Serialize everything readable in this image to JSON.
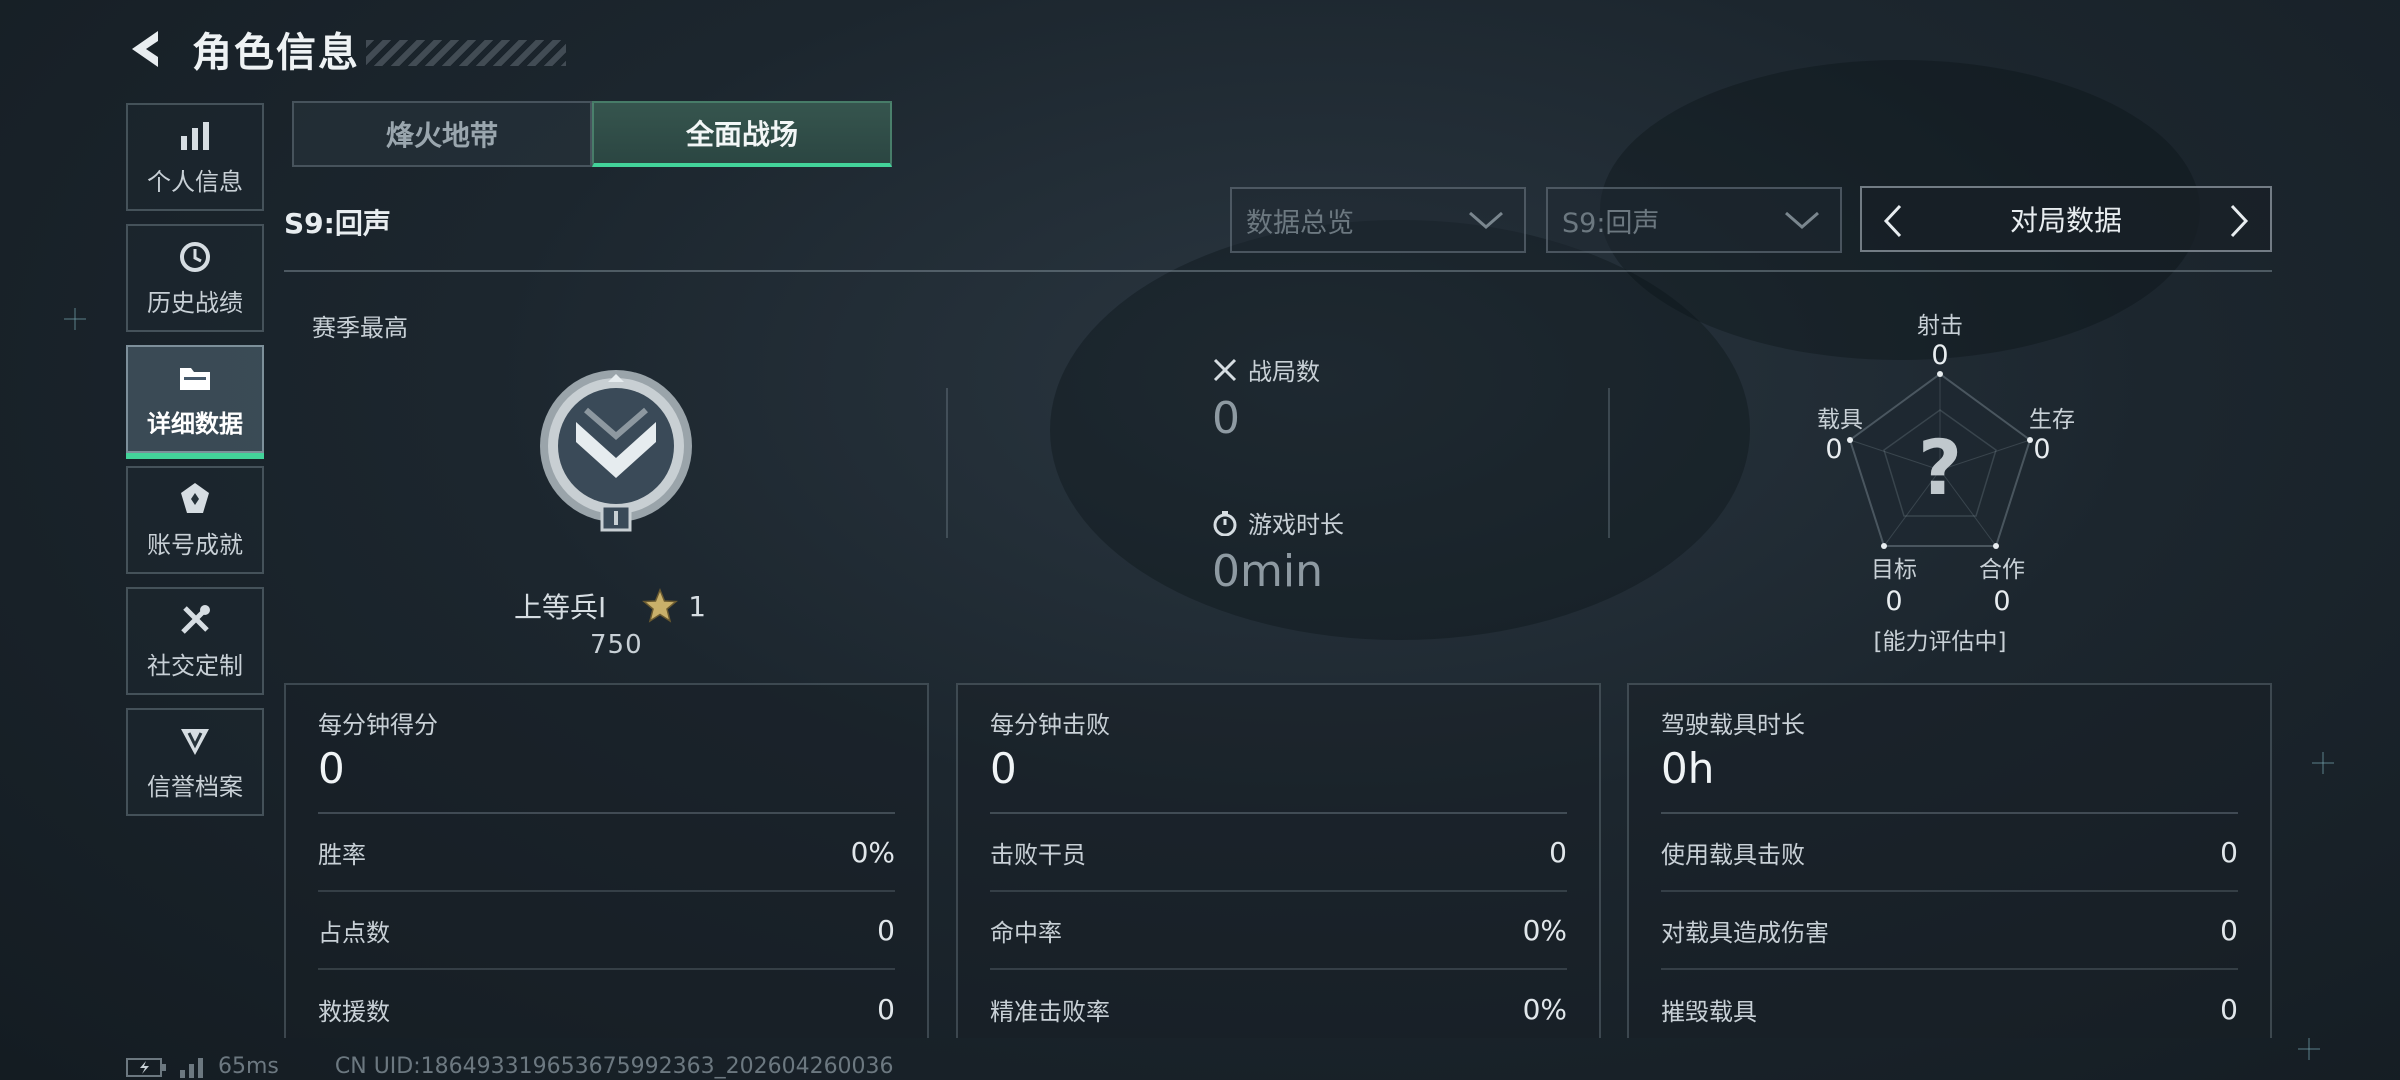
{
  "header": {
    "title": "角色信息"
  },
  "sidebar": {
    "items": [
      {
        "label": "个人信息",
        "icon": "bar-chart-icon"
      },
      {
        "label": "历史战绩",
        "icon": "history-icon"
      },
      {
        "label": "详细数据",
        "icon": "folder-icon",
        "active": true
      },
      {
        "label": "账号成就",
        "icon": "achievement-icon"
      },
      {
        "label": "社交定制",
        "icon": "tools-icon"
      },
      {
        "label": "信誉档案",
        "icon": "credit-icon"
      }
    ]
  },
  "tabs": [
    {
      "label": "烽火地带",
      "active": false
    },
    {
      "label": "全面战场",
      "active": true
    }
  ],
  "season_label": "S9:回声",
  "filters": {
    "category": "数据总览",
    "season": "S9:回声",
    "nav_label": "对局数据"
  },
  "rank": {
    "section_title": "赛季最高",
    "name": "上等兵Ⅰ",
    "stars": "1",
    "points": "750"
  },
  "middle": {
    "matches_label": "战局数",
    "matches_value": "0",
    "playtime_label": "游戏时长",
    "playtime_value": "0min"
  },
  "radar": {
    "axes": [
      {
        "label": "射击",
        "value": "0"
      },
      {
        "label": "生存",
        "value": "0"
      },
      {
        "label": "合作",
        "value": "0"
      },
      {
        "label": "目标",
        "value": "0"
      },
      {
        "label": "载具",
        "value": "0"
      }
    ],
    "center_symbol": "?",
    "status": "[能力评估中]"
  },
  "panels": [
    {
      "title": "每分钟得分",
      "value": "0",
      "rows": [
        {
          "label": "胜率",
          "value": "0%"
        },
        {
          "label": "占点数",
          "value": "0"
        },
        {
          "label": "救援数",
          "value": "0"
        }
      ]
    },
    {
      "title": "每分钟击败",
      "value": "0",
      "rows": [
        {
          "label": "击败干员",
          "value": "0"
        },
        {
          "label": "命中率",
          "value": "0%"
        },
        {
          "label": "精准击败率",
          "value": "0%"
        }
      ]
    },
    {
      "title": "驾驶载具时长",
      "value": "0h",
      "rows": [
        {
          "label": "使用载具击败",
          "value": "0"
        },
        {
          "label": "对载具造成伤害",
          "value": "0"
        },
        {
          "label": "摧毁载具",
          "value": "0"
        }
      ]
    }
  ],
  "footer": {
    "ping": "65ms",
    "uid": "CN UID:1864933196536759923​63_202604260036"
  },
  "colors": {
    "accent": "#43d39a"
  }
}
